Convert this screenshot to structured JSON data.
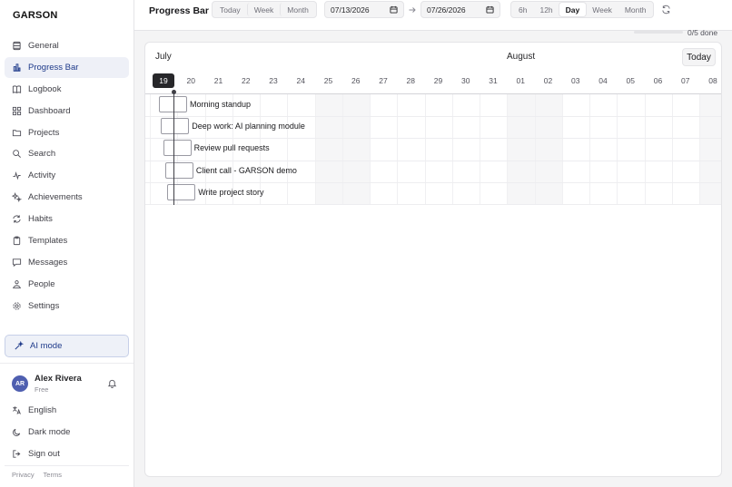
{
  "brand": "GARSON",
  "sidebar": {
    "items": [
      {
        "label": "General",
        "icon": "settings-sliders-icon"
      },
      {
        "label": "Progress Bar",
        "icon": "bar-chart-icon",
        "active": true
      },
      {
        "label": "Logbook",
        "icon": "book-icon"
      },
      {
        "label": "Dashboard",
        "icon": "grid-icon"
      },
      {
        "label": "Projects",
        "icon": "folder-icon"
      },
      {
        "label": "Search",
        "icon": "search-icon"
      },
      {
        "label": "Activity",
        "icon": "activity-icon"
      },
      {
        "label": "Achievements",
        "icon": "sparkle-icon"
      },
      {
        "label": "Habits",
        "icon": "repeat-icon"
      },
      {
        "label": "Templates",
        "icon": "clipboard-icon"
      },
      {
        "label": "Messages",
        "icon": "message-icon"
      },
      {
        "label": "People",
        "icon": "people-icon"
      },
      {
        "label": "Settings",
        "icon": "gear-icon"
      }
    ],
    "ai_mode": "AI mode",
    "user": {
      "initials": "AR",
      "name": "Alex Rivera",
      "plan": "Free"
    },
    "bottom": [
      {
        "label": "English",
        "icon": "language-icon"
      },
      {
        "label": "Dark mode",
        "icon": "moon-icon"
      },
      {
        "label": "Sign out",
        "icon": "sign-out-icon"
      }
    ],
    "footer": {
      "privacy": "Privacy",
      "terms": "Terms"
    }
  },
  "topbar": {
    "title": "Progress Bar",
    "range_tabs": [
      "Today",
      "Week",
      "Month"
    ],
    "start_date": "07/13/2026",
    "end_date": "07/26/2026",
    "zoom_tabs": [
      "6h",
      "12h",
      "Day",
      "Week",
      "Month"
    ],
    "zoom_selected": "Day"
  },
  "progress": {
    "label": "0/5 done",
    "fraction": 0
  },
  "timeline": {
    "months": [
      "July",
      "August"
    ],
    "today_button": "Today",
    "days": [
      "19",
      "20",
      "21",
      "22",
      "23",
      "24",
      "25",
      "26",
      "27",
      "28",
      "29",
      "30",
      "31",
      "01",
      "02",
      "03",
      "04",
      "05",
      "06",
      "07",
      "08"
    ],
    "selected_day": "19",
    "tasks": [
      "Morning standup",
      "Deep work: AI planning module",
      "Review pull requests",
      "Client call - GARSON demo",
      "Write project story"
    ]
  },
  "colors": {
    "accent": "#3f51b5",
    "active_bg": "#eef0f7"
  }
}
